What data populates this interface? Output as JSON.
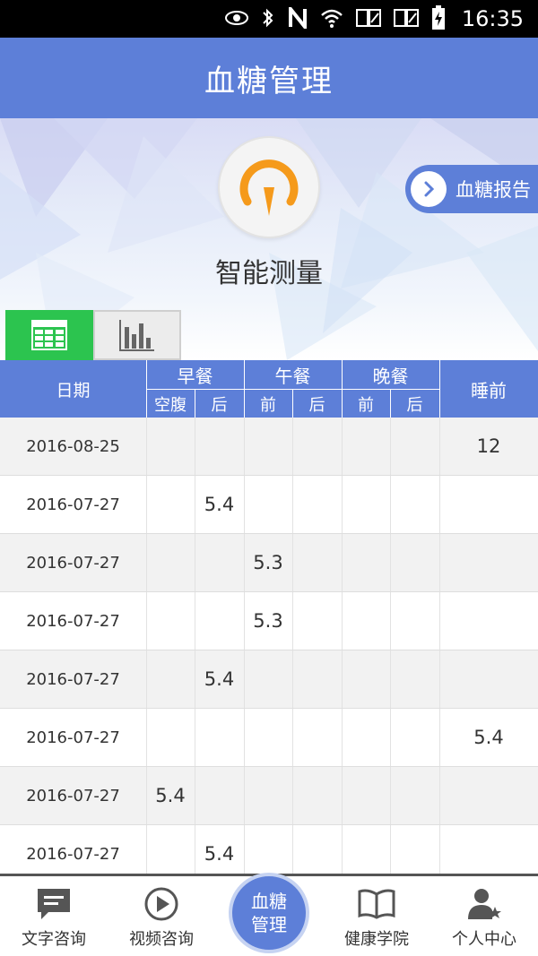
{
  "status_bar": {
    "time": "16:35"
  },
  "header": {
    "title": "血糖管理"
  },
  "banner": {
    "measure_label": "智能测量",
    "report_label": "血糖报告"
  },
  "table": {
    "headers": {
      "date": "日期",
      "breakfast": "早餐",
      "lunch": "午餐",
      "dinner": "晚餐",
      "bedtime": "睡前",
      "fasting": "空腹",
      "after": "后",
      "before": "前"
    },
    "rows": [
      {
        "date": "2016-08-25",
        "c1": "",
        "c2": "",
        "c3": "",
        "c4": "",
        "c5": "",
        "c6": "",
        "c7": "12"
      },
      {
        "date": "2016-07-27",
        "c1": "",
        "c2": "5.4",
        "c3": "",
        "c4": "",
        "c5": "",
        "c6": "",
        "c7": ""
      },
      {
        "date": "2016-07-27",
        "c1": "",
        "c2": "",
        "c3": "5.3",
        "c4": "",
        "c5": "",
        "c6": "",
        "c7": ""
      },
      {
        "date": "2016-07-27",
        "c1": "",
        "c2": "",
        "c3": "5.3",
        "c4": "",
        "c5": "",
        "c6": "",
        "c7": ""
      },
      {
        "date": "2016-07-27",
        "c1": "",
        "c2": "5.4",
        "c3": "",
        "c4": "",
        "c5": "",
        "c6": "",
        "c7": ""
      },
      {
        "date": "2016-07-27",
        "c1": "",
        "c2": "",
        "c3": "",
        "c4": "",
        "c5": "",
        "c6": "",
        "c7": "5.4"
      },
      {
        "date": "2016-07-27",
        "c1": "5.4",
        "c2": "",
        "c3": "",
        "c4": "",
        "c5": "",
        "c6": "",
        "c7": ""
      },
      {
        "date": "2016-07-27",
        "c1": "",
        "c2": "5.4",
        "c3": "",
        "c4": "",
        "c5": "",
        "c6": "",
        "c7": ""
      }
    ]
  },
  "nav": {
    "text_consult": "文字咨询",
    "video_consult": "视频咨询",
    "center_line1": "血糖",
    "center_line2": "管理",
    "health_academy": "健康学院",
    "personal_center": "个人中心"
  },
  "colors": {
    "primary": "#5d7fd8",
    "green": "#2cc44f",
    "orange": "#f59a1b"
  }
}
